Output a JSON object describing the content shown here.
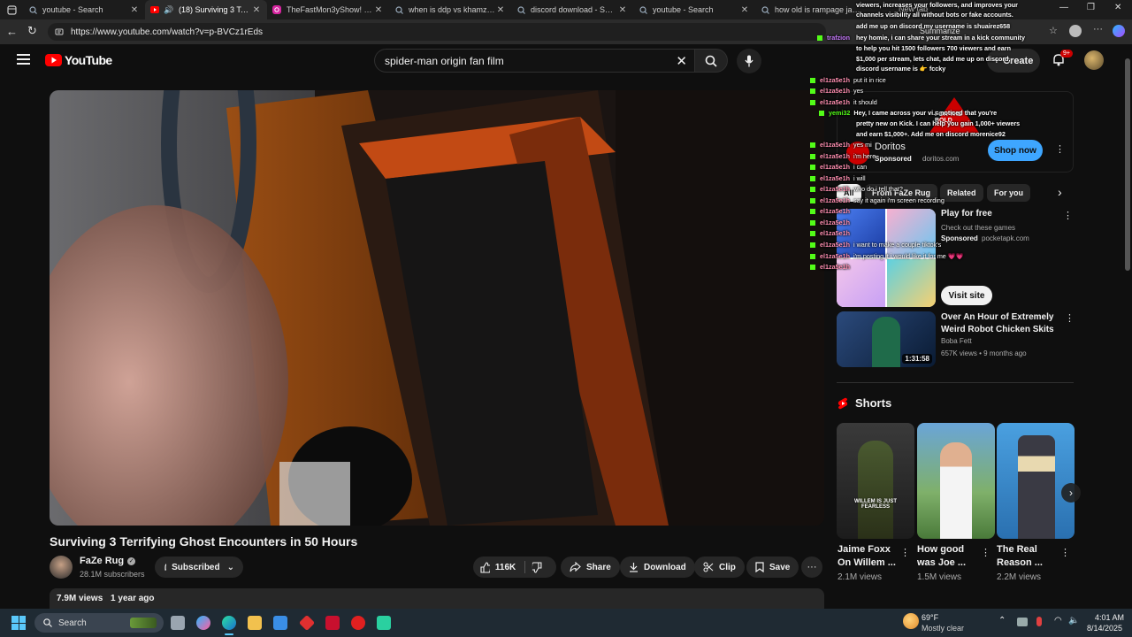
{
  "browser": {
    "tabs": [
      {
        "label": "youtube - Search",
        "icon": "search-icon"
      },
      {
        "label": "(18) Surviving 3 Terrify",
        "icon": "youtube-icon"
      },
      {
        "label": "TheFastMon3yShow! (@fa",
        "icon": "instagram-icon"
      },
      {
        "label": "when is ddp vs khamzat - S",
        "icon": "search-icon"
      },
      {
        "label": "discord download - Search",
        "icon": "search-icon"
      },
      {
        "label": "youtube - Search",
        "icon": "search-icon"
      },
      {
        "label": "how old is rampage jacks",
        "icon": "search-icon"
      }
    ],
    "url": "https://www.youtube.com/watch?v=p-BVCz1rEds",
    "new_tab_label": "New tab",
    "summarize_label": "Summarize"
  },
  "youtube": {
    "logo_text": "YouTube",
    "search_value": "spider-man origin fan film",
    "create_label": "Create",
    "notification_badge": "9+"
  },
  "video": {
    "title": "Surviving 3 Terrifying Ghost Encounters in 50 Hours",
    "channel": "FaZe Rug",
    "subscribers": "28.1M subscribers",
    "subscribed_label": "Subscribed",
    "likes": "116K",
    "share_label": "Share",
    "download_label": "Download",
    "clip_label": "Clip",
    "save_label": "Save",
    "views": "7.9M views",
    "age": "1 year ago"
  },
  "ad1": {
    "name": "Doritos",
    "sponsored": "Sponsored",
    "domain": "doritos.com",
    "cta": "Shop now",
    "logo_text": "FOR THE BOLD"
  },
  "chips": [
    "All",
    "From FaZe Rug",
    "Related",
    "For you"
  ],
  "ad2": {
    "title": "Play for free",
    "desc": "Check out these games",
    "sponsored": "Sponsored",
    "domain": "pocketapk.com",
    "cta": "Visit site"
  },
  "rec": {
    "title": "Over An Hour of Extremely Weird Robot Chicken Skits",
    "channel": "Boba Fett",
    "meta": "657K views • 9 months ago",
    "duration": "1:31:58"
  },
  "shorts": {
    "heading": "Shorts",
    "items": [
      {
        "title": "Jaime Foxx On Willem ...",
        "views": "2.1M views",
        "caption": "WILLEM IS JUST FEARLESS"
      },
      {
        "title": "How good was Joe ...",
        "views": "1.5M views"
      },
      {
        "title": "The Real Reason ...",
        "views": "2.2M views"
      }
    ]
  },
  "chat": {
    "lines": [
      {
        "user": "",
        "text": "viewers, increases your followers, and improves your",
        "bold": true
      },
      {
        "user": "",
        "text": "channels visibility all without bots or fake accounts.",
        "bold": true
      },
      {
        "user": "trafzion",
        "text": "",
        "bold": true
      },
      {
        "user": "",
        "text": "add me up on discord my username is shuairez658",
        "bold": true
      },
      {
        "user": "",
        "text": "hey homie, i can share your stream in a kick community",
        "bold": true
      },
      {
        "user": "",
        "text": "to help you hit 1500 followers 700 viewers and earn",
        "bold": true
      },
      {
        "user": "",
        "text": "$1,000 per stream, lets chat, add me up on discord,",
        "bold": true
      },
      {
        "user": "",
        "text": "discord username is 👉 fccky",
        "bold": true
      },
      {
        "user": "el1za5e1h",
        "text": "put it in rice",
        "bold": false
      },
      {
        "user": "el1za5e1h",
        "text": "yes",
        "bold": false
      },
      {
        "user": "el1za5e1h",
        "text": "it should",
        "bold": false
      },
      {
        "user": "yemi32",
        "text": "Hey, I came across your vi... noticed that you're",
        "bold": true
      },
      {
        "user": "",
        "text": "pretty new on Kick. I can help you gain 1,000+ viewers",
        "bold": true
      },
      {
        "user": "",
        "text": "and earn $1,000+. Add me on discord morenice92",
        "bold": true
      },
      {
        "user": "el1za5e1h",
        "text": "yes mi",
        "bold": false
      },
      {
        "user": "el1za5e1h",
        "text": "i'm here",
        "bold": false
      },
      {
        "user": "el1za5e1h",
        "text": "i can",
        "bold": false
      },
      {
        "user": "el1za5e1h",
        "text": "i will",
        "bold": false
      },
      {
        "user": "el1za5e1h",
        "text": "who do i tell that?",
        "bold": false
      },
      {
        "user": "el1za5e1h",
        "text": "say it again i'm screen recording",
        "bold": false
      },
      {
        "user": "el1za5e1h",
        "text": "",
        "bold": false
      },
      {
        "user": "el1za5e1h",
        "text": "",
        "bold": false
      },
      {
        "user": "el1za5e1h",
        "text": "i want to make a couple tiktok's",
        "bold": false
      },
      {
        "user": "el1za5e1h",
        "text": "i'm posting it i would like it for me 💗💗",
        "bold": false
      },
      {
        "user": "el1za5e1h",
        "text": "",
        "bold": false
      },
      {
        "user": "el1za5e1h",
        "text": "",
        "bold": false
      }
    ]
  },
  "taskbar": {
    "search_label": "Search",
    "temperature": "69°F",
    "weather": "Mostly clear",
    "time": "4:01 AM",
    "date": "8/14/2025"
  },
  "colors": {
    "background": "#0f0f0f",
    "youtube_red": "#ff0000",
    "shop_now": "#3ea6ff",
    "kick_green": "#53fc18",
    "chat_user": "#ff8fb1"
  }
}
